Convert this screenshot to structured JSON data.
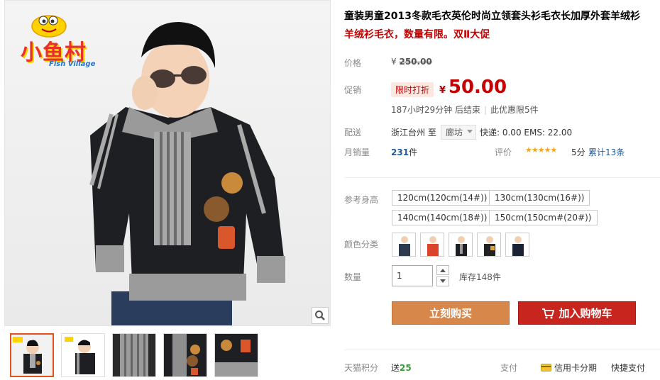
{
  "product": {
    "title": "童装男童2013冬款毛衣英伦时尚立领套头衫毛衣长加厚外套羊绒衫",
    "subtitle": "羊绒衫毛衣，数量有限。双Ⅱ大促"
  },
  "brand": {
    "logo_main": "小鱼村",
    "logo_sub": "Fish Village"
  },
  "price": {
    "label": "价格",
    "currency": "¥",
    "original": "250.00"
  },
  "promotion": {
    "label": "促销",
    "badge": "限时打折",
    "currency": "¥",
    "price": "50.00",
    "countdown": "187小时29分钟 后结束",
    "limit": "此优惠限5件"
  },
  "shipping": {
    "label": "配送",
    "from": "浙江台州 至",
    "to": "廊坊",
    "fees": "快递: 0.00 EMS: 22.00"
  },
  "sales": {
    "label": "月销量",
    "count": "231",
    "unit": "件"
  },
  "rating": {
    "label": "评价",
    "stars": 5,
    "star_glyphs": "★★★★★",
    "score": "5分",
    "total": "累计13条"
  },
  "sizes": {
    "label": "参考身高",
    "options": [
      "120cm(120cm(14#))",
      "130cm(130cm(16#))",
      "140cm(140cm(18#))",
      "150cm(150cm#(20#))"
    ]
  },
  "colors": {
    "label": "颜色分类",
    "count": 5
  },
  "quantity": {
    "label": "数量",
    "value": "1",
    "stock": "库存148件"
  },
  "actions": {
    "buy_now": "立刻购买",
    "add_to_cart": "加入购物车"
  },
  "footer": {
    "points_label": "天猫积分",
    "points_text": "送",
    "points_value": "25",
    "pay_label": "支付",
    "credit": "信用卡分期",
    "quick_pay": "快捷支付"
  },
  "colors_theme": {
    "accent_red": "#c40000",
    "buy_button": "#d8874a",
    "cart_button": "#c7251e",
    "link_blue": "#1f5a9a",
    "star": "#f5a623"
  },
  "icons": [
    "zoom-icon",
    "cart-icon",
    "credit-card-icon",
    "arrow-up-icon",
    "arrow-down-icon",
    "caret-down-icon"
  ]
}
